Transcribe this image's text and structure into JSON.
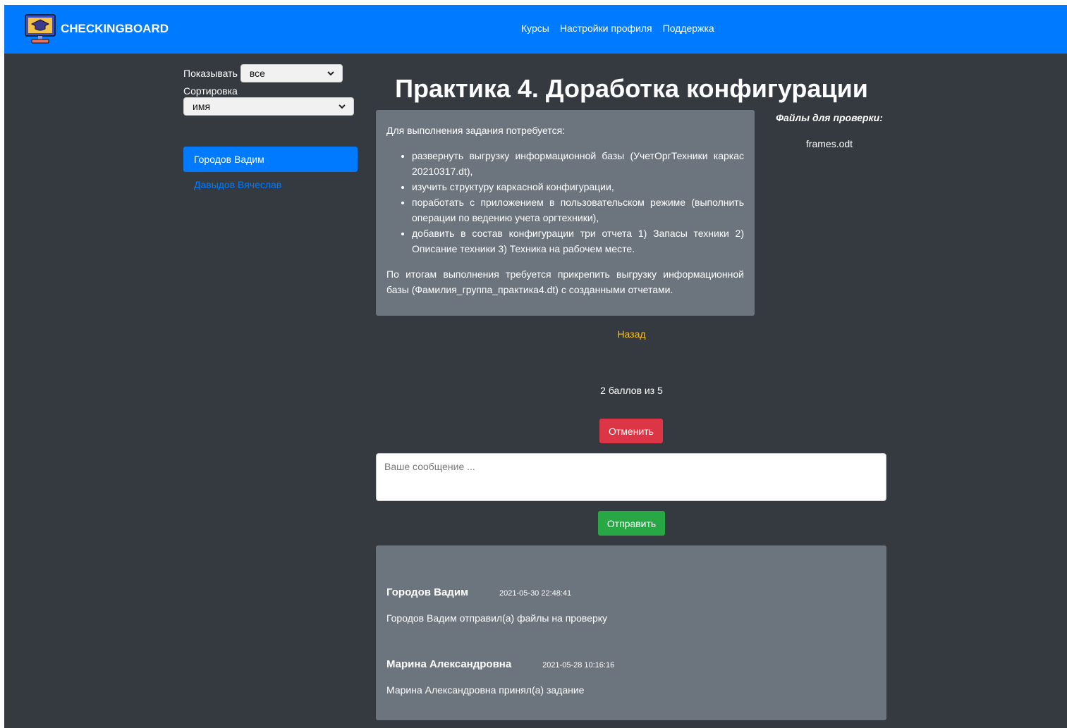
{
  "navbar": {
    "brand": "CHECKINGBOARD",
    "links": [
      "Курсы",
      "Настройки профиля",
      "Поддержка"
    ]
  },
  "sidebar": {
    "show_label": "Показывать",
    "show_value": "все",
    "sort_label": "Сортировка",
    "sort_value": "имя",
    "users": [
      {
        "name": "Городов Вадим",
        "active": true
      },
      {
        "name": "Давыдов Вячеслав",
        "active": false
      }
    ]
  },
  "task": {
    "title": "Практика 4. Доработка конфигурации",
    "intro": "Для выполнения задания потребуется:",
    "items": [
      "развернуть выгрузку информационной базы (УчетОргТехники каркас 20210317.dt),",
      "изучить структуру каркасной конфигурации,",
      "поработать с приложением в пользовательском режиме (выполнить операции по ведению учета оргтехники),",
      "добавить в состав конфигурации три отчета 1) Запасы техники 2) Описание техники 3) Техника на рабочем месте."
    ],
    "outro": "По итогам выполнения требуется прикрепить выгрузку информационной базы (Фамилия_группа_практика4.dt) с созданными отчетами."
  },
  "files": {
    "title": "Файлы для проверки:",
    "items": [
      "frames.odt"
    ]
  },
  "back_label": "Назад",
  "score_text": "2 баллов из 5",
  "cancel_label": "Отменить",
  "message": {
    "placeholder": "Ваше сообщение ...",
    "value": ""
  },
  "send_label": "Отправить",
  "comments": [
    {
      "author": "Городов Вадим",
      "time": "2021-05-30 22:48:41",
      "text": "Городов Вадим отправил(а) файлы на проверку"
    },
    {
      "author": "Марина Александровна",
      "time": "2021-05-28 10:16:16",
      "text": "Марина Александровна принял(а) задание"
    }
  ],
  "colors": {
    "primary": "#007bff",
    "background": "#343a40",
    "card": "#6c757d",
    "danger": "#dc3545",
    "success": "#28a745",
    "warning": "#ffc107"
  }
}
